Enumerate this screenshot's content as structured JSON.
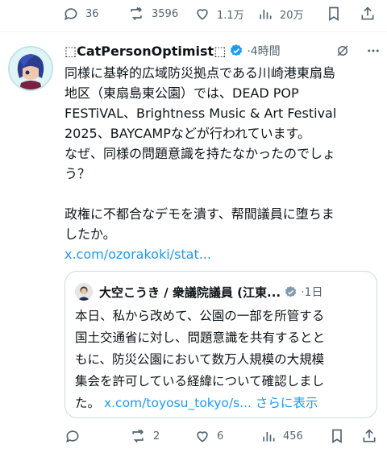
{
  "top_actions": {
    "replies": "36",
    "retweets": "3596",
    "likes": "1.1万",
    "views": "20万"
  },
  "tweet": {
    "author_name": "⬚CatPersonOptimist⬚",
    "time": "·4時間",
    "body_lines": [
      "同様に基幹的広域防災拠点である川崎港東扇島",
      "地区（東扇島東公園）では、DEAD POP",
      "FESTiVAL、Brightness Music & Art Festival",
      "2025、BAYCAMPなどが行われています。",
      "なぜ、同様の問題意識を持たなかったのでしょ",
      "う？"
    ],
    "body_lines_2": [
      "政権に不都合なデモを潰す、帮間議員に堕ちま",
      "したか。"
    ],
    "link_text": "x.com/ozorakoki/stat...",
    "quote": {
      "author_name": "大空こうき / 衆議院議員 (江東...",
      "time": "·1日",
      "lines": [
        "本日、私から改めて、公園の一部を所管する",
        "国土交通省に対し、問題意識を共有するとと",
        "もに、防災公園において数万人規模の大規模",
        "集会を許可している経緯について確認しまし"
      ],
      "last_line_prefix": "た。",
      "last_line_link": "x.com/toyosu_tokyo/s...",
      "show_more": "さらに表示"
    }
  },
  "bottom_actions": {
    "replies": "",
    "retweets": "2",
    "likes": "6",
    "views": "456"
  },
  "colors": {
    "accent": "#1d9bf0",
    "text": "#0f1419",
    "muted": "#536471",
    "border": "#cfd9de"
  }
}
